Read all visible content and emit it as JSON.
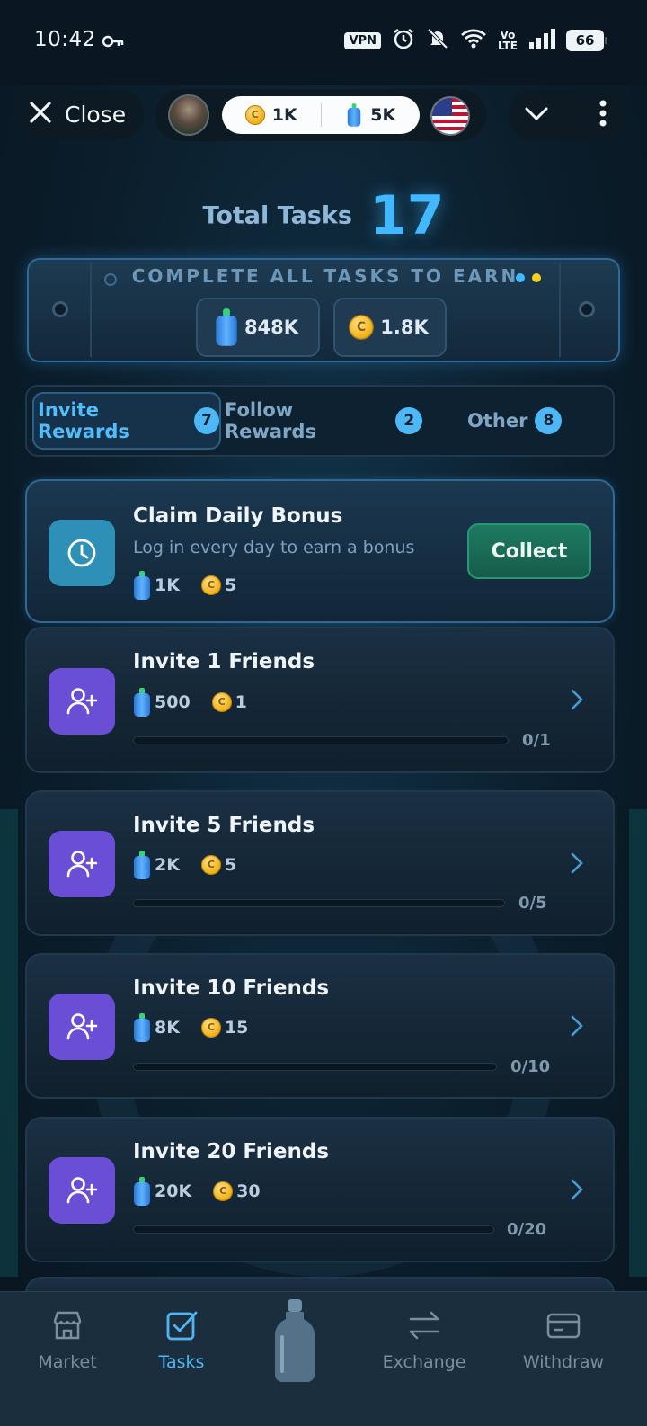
{
  "status_bar": {
    "time": "10:42",
    "vpn": "VPN",
    "battery": "66"
  },
  "topbar": {
    "close_label": "Close",
    "coins": "1K",
    "bottles": "5K"
  },
  "summary": {
    "label": "Total Tasks",
    "count": "17",
    "heading": "COMPLETE ALL TASKS TO EARN",
    "bottle_reward": "848K",
    "coin_reward": "1.8K"
  },
  "tabs": [
    {
      "label": "Invite Rewards",
      "count": "7"
    },
    {
      "label": "Follow Rewards",
      "count": "2"
    },
    {
      "label": "Other",
      "count": "8"
    }
  ],
  "daily": {
    "title": "Claim Daily Bonus",
    "desc": "Log in every day to earn a bonus",
    "bottles": "1K",
    "coins": "5",
    "button": "Collect"
  },
  "tasks": [
    {
      "title": "Invite 1 Friends",
      "bottles": "500",
      "coins": "1",
      "progress": "0/1",
      "fraction": 0
    },
    {
      "title": "Invite 5 Friends",
      "bottles": "2K",
      "coins": "5",
      "progress": "0/5",
      "fraction": 0
    },
    {
      "title": "Invite 10 Friends",
      "bottles": "8K",
      "coins": "15",
      "progress": "0/10",
      "fraction": 0
    },
    {
      "title": "Invite 20 Friends",
      "bottles": "20K",
      "coins": "30",
      "progress": "0/20",
      "fraction": 0
    }
  ],
  "nav": [
    {
      "label": "Market",
      "icon": "store-icon"
    },
    {
      "label": "Tasks",
      "icon": "check-square-icon"
    },
    {
      "label": "",
      "icon": "bottle-icon"
    },
    {
      "label": "Exchange",
      "icon": "swap-arrows-icon"
    },
    {
      "label": "Withdraw",
      "icon": "card-icon"
    }
  ],
  "colors": {
    "accent": "#41b8ff",
    "active_tab": "#53bdfb",
    "collect": "#1e7a62",
    "invite_icon": "#6a4fd6",
    "daily_icon": "#2e8fb7"
  }
}
